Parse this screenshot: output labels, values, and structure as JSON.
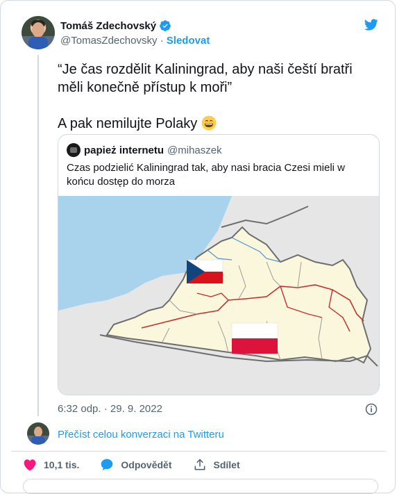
{
  "author": {
    "name": "Tomáš Zdechovský",
    "handle": "@TomasZdechovsky",
    "separator": "·",
    "follow_label": "Sledovat"
  },
  "tweet": {
    "line1": "“Je čas rozdělit Kaliningrad, aby naši čeští bratři měli konečně přístup k moři”",
    "line2": "A pak nemilujte Polaky",
    "emoji": "grinning-face-smiling-eyes"
  },
  "quote": {
    "name": "papież internetu",
    "handle": "@mihaszek",
    "text": "Czas podzielić Kaliningrad tak, aby nasi bracia Czesi mieli w końcu dostęp do morza"
  },
  "meta": {
    "timestamp": "6:32 odp. · 29. 9. 2022"
  },
  "conversation_link": "Přečíst celou konverzaci na Twitteru",
  "actions": {
    "likes": "10,1 tis.",
    "reply_label": "Odpovědět",
    "share_label": "Sdílet"
  },
  "colors": {
    "twitter_blue": "#1d9bf0",
    "like_red": "#f91880",
    "text_gray": "#536471",
    "border": "#cfd9de"
  },
  "icons": [
    "verified-badge-icon",
    "twitter-bird-icon",
    "info-icon",
    "heart-icon",
    "reply-icon",
    "share-icon"
  ]
}
